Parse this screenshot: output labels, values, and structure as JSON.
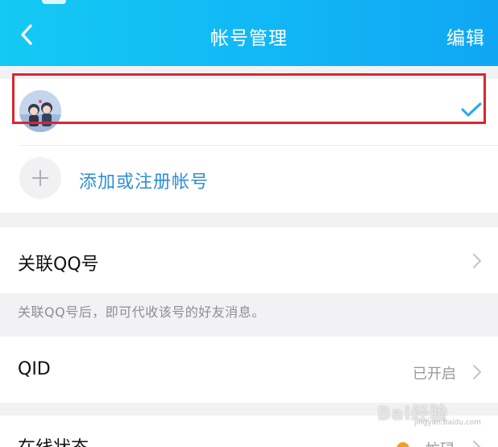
{
  "nav": {
    "title": "帐号管理",
    "edit_label": "编辑"
  },
  "accounts": {
    "add_label": "添加或注册帐号"
  },
  "linked_qq": {
    "label": "关联QQ号",
    "note": "关联QQ号后，即可代收该号的好友消息。"
  },
  "qid": {
    "label": "QID",
    "value": "已开启"
  },
  "online_status": {
    "label": "在线状态",
    "value": "忙碌"
  },
  "watermark": {
    "text": "Bai经验",
    "sub": "jingyan.baidu.com"
  },
  "colors": {
    "nav_gradient_start": "#14c9f4",
    "nav_gradient_end": "#0fa6f3",
    "accent_blue": "#2f8fd4",
    "check_blue": "#2aa6ea",
    "highlight_red": "#d8282e",
    "status_orange": "#f3a02a"
  },
  "icons": [
    "back-arrow-icon",
    "checkmark-icon",
    "plus-icon",
    "chevron-right-icon",
    "status-dot-icon"
  ]
}
